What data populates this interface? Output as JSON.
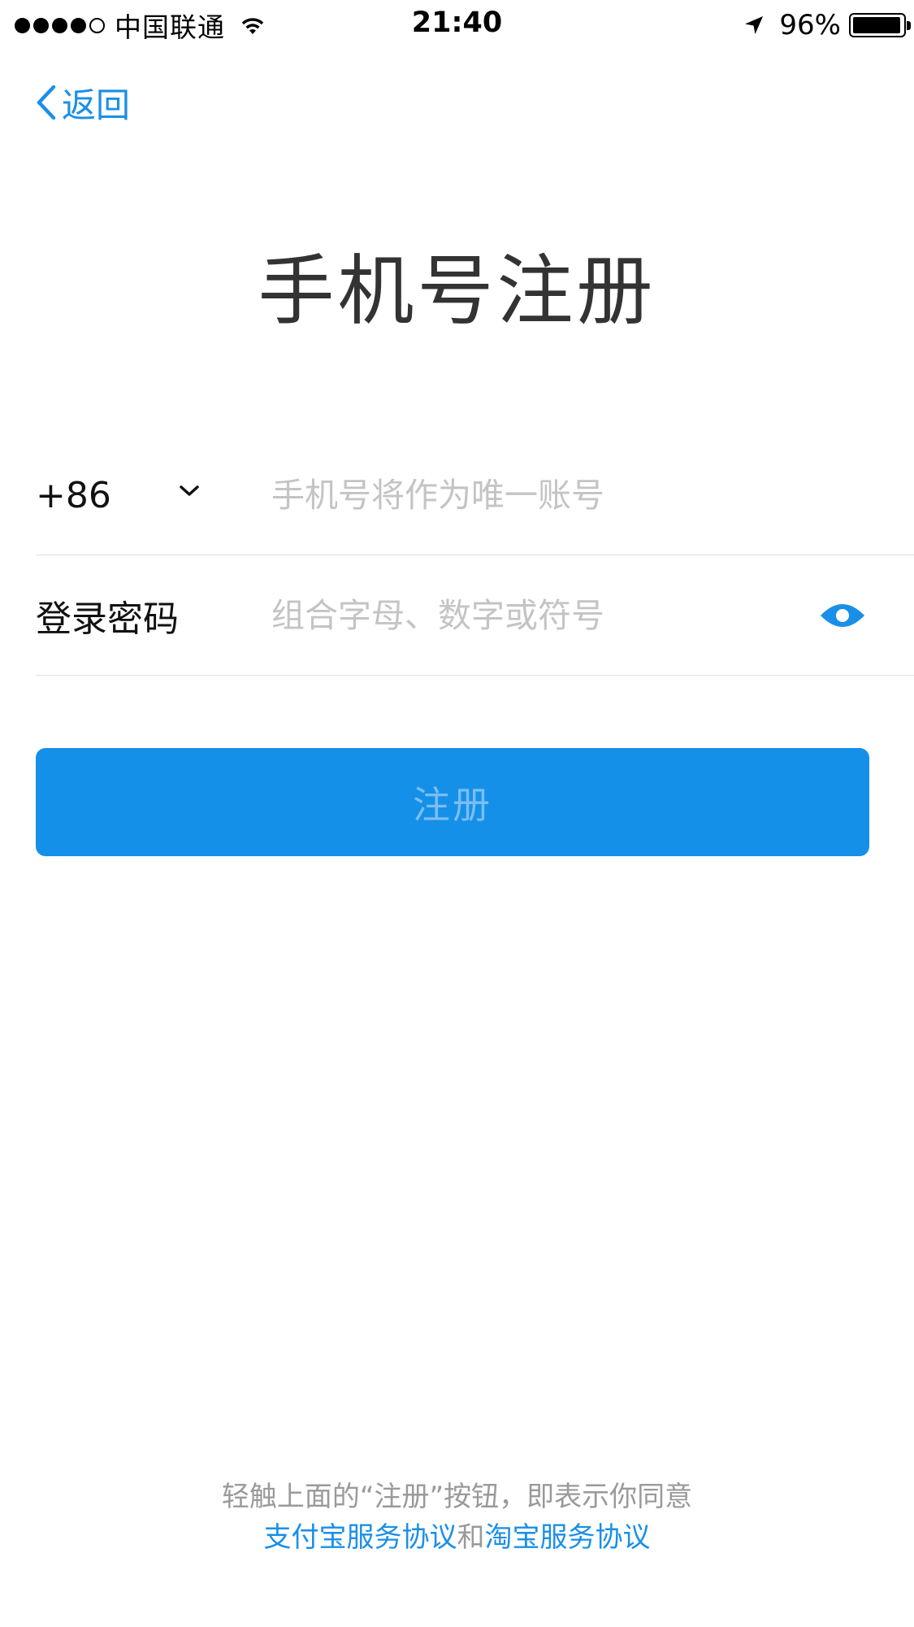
{
  "status_bar": {
    "carrier": "中国联通",
    "time": "21:40",
    "battery": "96%",
    "battery_level": 0.96,
    "signal_dots_filled": 4,
    "signal_dots_total": 5
  },
  "nav": {
    "back_label": "返回"
  },
  "page": {
    "title": "手机号注册"
  },
  "phone_row": {
    "country_code": "+86",
    "placeholder": "手机号将作为唯一账号",
    "value": ""
  },
  "password_row": {
    "label": "登录密码",
    "placeholder": "组合字母、数字或符号",
    "value": ""
  },
  "actions": {
    "register_label": "注册"
  },
  "agreement": {
    "line1": "轻触上面的“注册”按钮，即表示你同意",
    "alipay_link": "支付宝服务协议",
    "and": "和",
    "taobao_link": "淘宝服务协议"
  },
  "colors": {
    "accent": "#1a8fe8",
    "button_bg": "#1490e8",
    "button_text_disabled": "#7cbdf2",
    "placeholder": "#c4c4c4",
    "divider": "#e2e2e2"
  },
  "icons": {
    "back": "chevron-left-icon",
    "country_dropdown": "chevron-down-icon",
    "password_visibility": "eye-icon",
    "wifi": "wifi-icon",
    "location": "location-arrow-icon",
    "battery": "battery-icon"
  }
}
